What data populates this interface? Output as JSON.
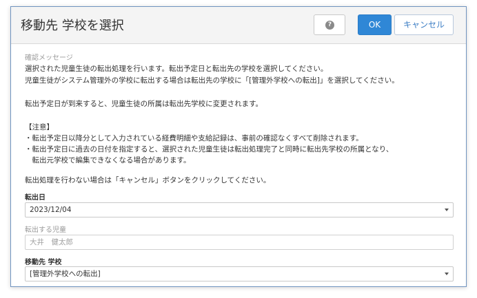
{
  "dialog": {
    "title": "移動先 学校を選択",
    "help_glyph": "?",
    "ok_label": "OK",
    "cancel_label": "キャンセル"
  },
  "message": {
    "label": "確認メッセージ",
    "lines": [
      "選択された児童生徒の転出処理を行います。転出予定日と転出先の学校を選択してください。",
      "児童生徒がシステム管理外の学校に転出する場合は転出先の学校に「[管理外学校への転出]」を選択してください。",
      "",
      "転出予定日が到来すると、児童生徒の所属は転出先学校に変更されます。",
      "",
      "【注意】",
      "・転出予定日以降分として入力されている経費明細や支給記録は、事前の確認なくすべて削除されます。",
      "・転出予定日に過去の日付を指定すると、選択された児童生徒は転出処理完了と同時に転出先学校の所属となり、",
      "　転出元学校で編集できなくなる場合があります。",
      "",
      "転出処理を行わない場合は「キャンセル」ボタンをクリックしてください。"
    ]
  },
  "form": {
    "transfer_date": {
      "label": "転出日",
      "value": "2023/12/04"
    },
    "student": {
      "label": "転出する児童",
      "value": "大井　健太郎"
    },
    "destination": {
      "label": "移動先 学校",
      "value": "[管理外学校への転出]"
    }
  }
}
